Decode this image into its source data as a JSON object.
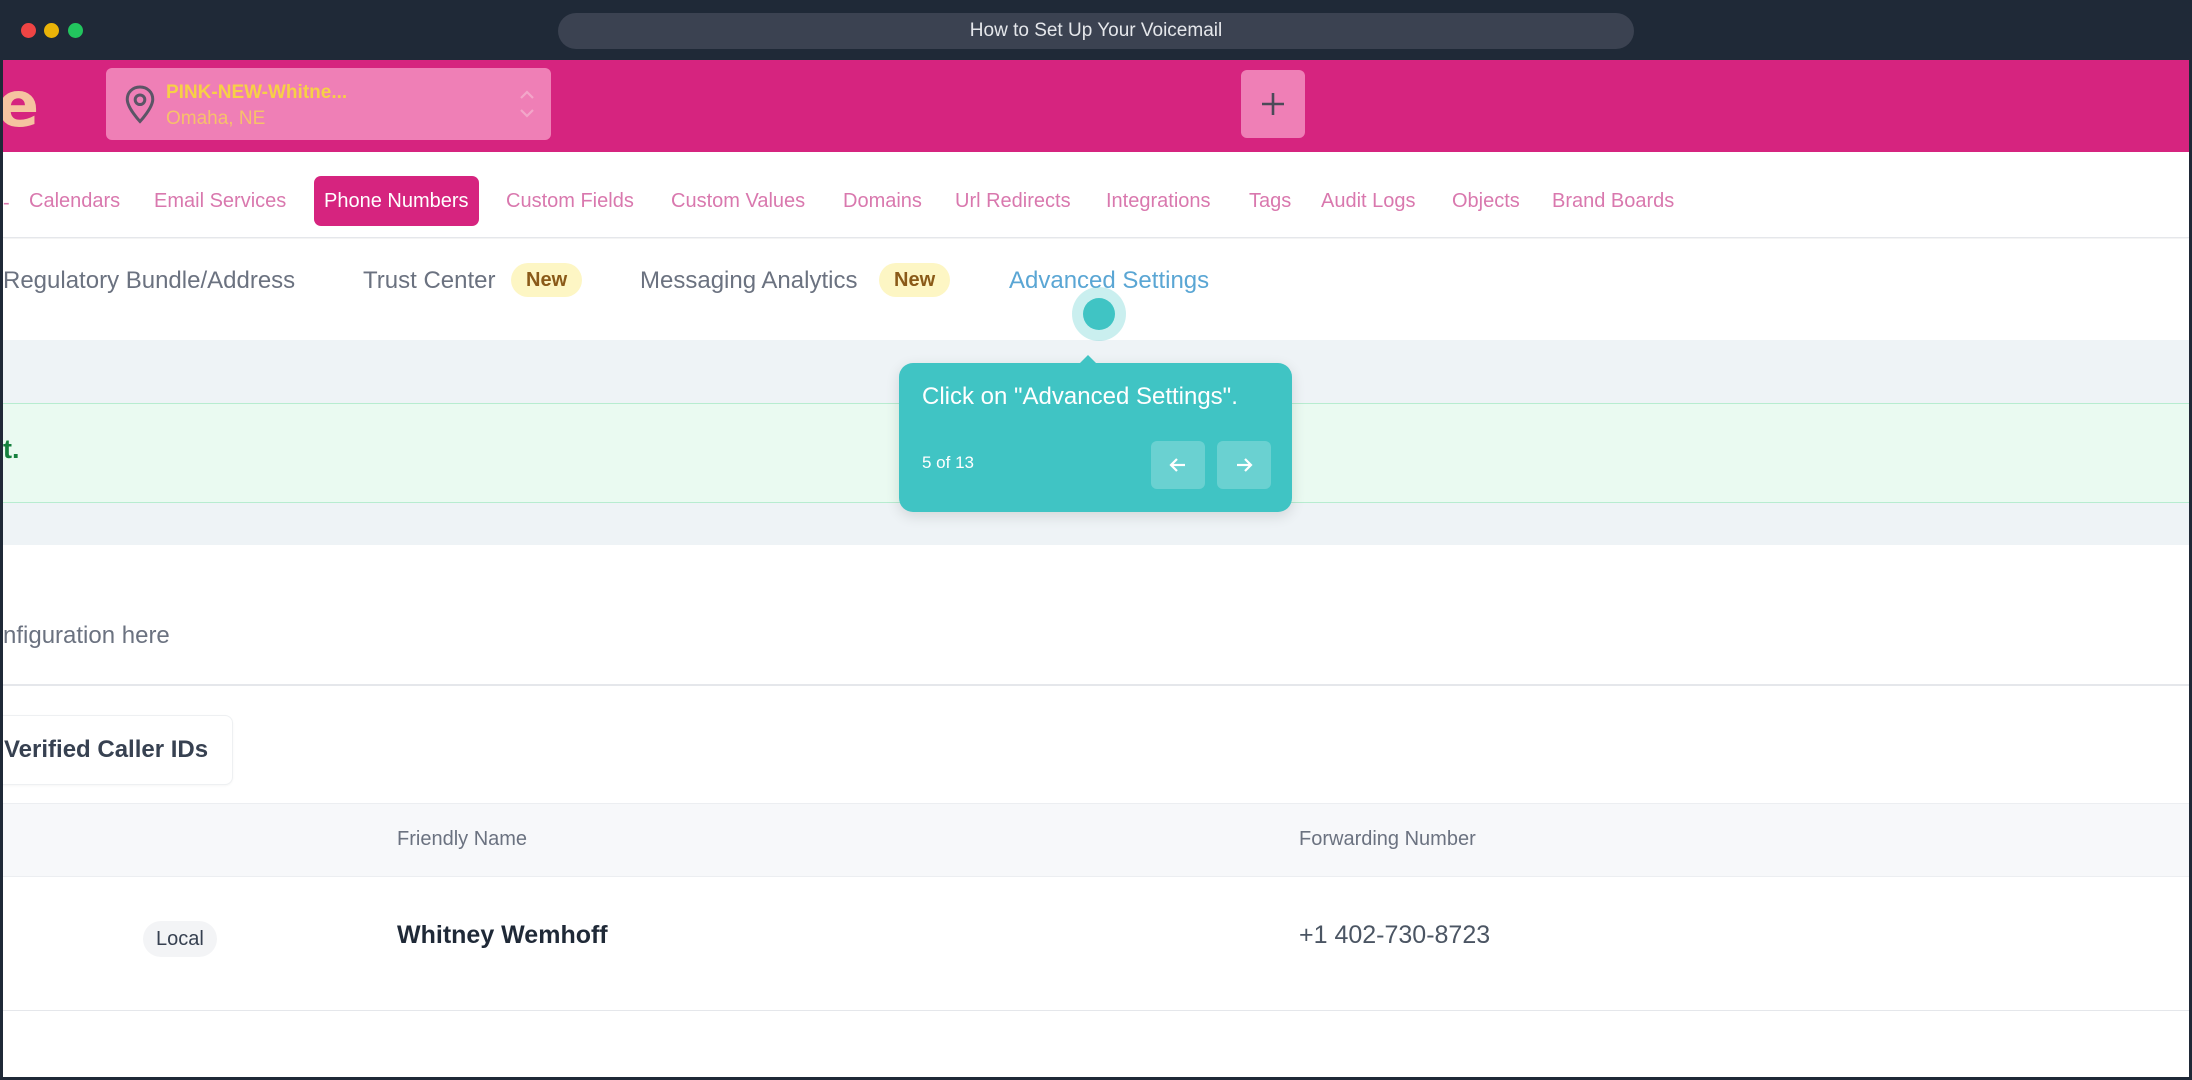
{
  "window": {
    "title": "How to Set Up Your Voicemail"
  },
  "header": {
    "logo_fragment": "e",
    "location": {
      "name": "PINK-NEW-Whitne...",
      "city": "Omaha, NE"
    }
  },
  "nav": {
    "leading_fragment": "-",
    "items": [
      {
        "label": "Calendars"
      },
      {
        "label": "Email Services"
      },
      {
        "label": "Phone Numbers",
        "active": true
      },
      {
        "label": "Custom Fields"
      },
      {
        "label": "Custom Values"
      },
      {
        "label": "Domains"
      },
      {
        "label": "Url Redirects"
      },
      {
        "label": "Integrations"
      },
      {
        "label": "Tags"
      },
      {
        "label": "Audit Logs"
      },
      {
        "label": "Objects"
      },
      {
        "label": "Brand Boards"
      }
    ]
  },
  "subtabs": {
    "regulatory": "Regulatory Bundle/Address",
    "trust": "Trust Center",
    "trust_badge": "New",
    "messaging": "Messaging Analytics",
    "messaging_badge": "New",
    "advanced": "Advanced Settings"
  },
  "banner": {
    "text_fragment": "t."
  },
  "config": {
    "text_fragment": "nfiguration here"
  },
  "caller_ids_tab": "Verified Caller IDs",
  "table": {
    "columns": {
      "friendly_name": "Friendly Name",
      "forwarding_number": "Forwarding Number"
    },
    "rows": [
      {
        "type": "Local",
        "friendly_name": "Whitney Wemhoff",
        "forwarding_number": "+1 402-730-8723"
      }
    ]
  },
  "tooltip": {
    "text": "Click on \"Advanced Settings\".",
    "step": "5 of 13"
  },
  "colors": {
    "brand_pink": "#d6247f",
    "tooltip_teal": "#40c4c4",
    "active_tab_blue": "#5aa6d4"
  }
}
